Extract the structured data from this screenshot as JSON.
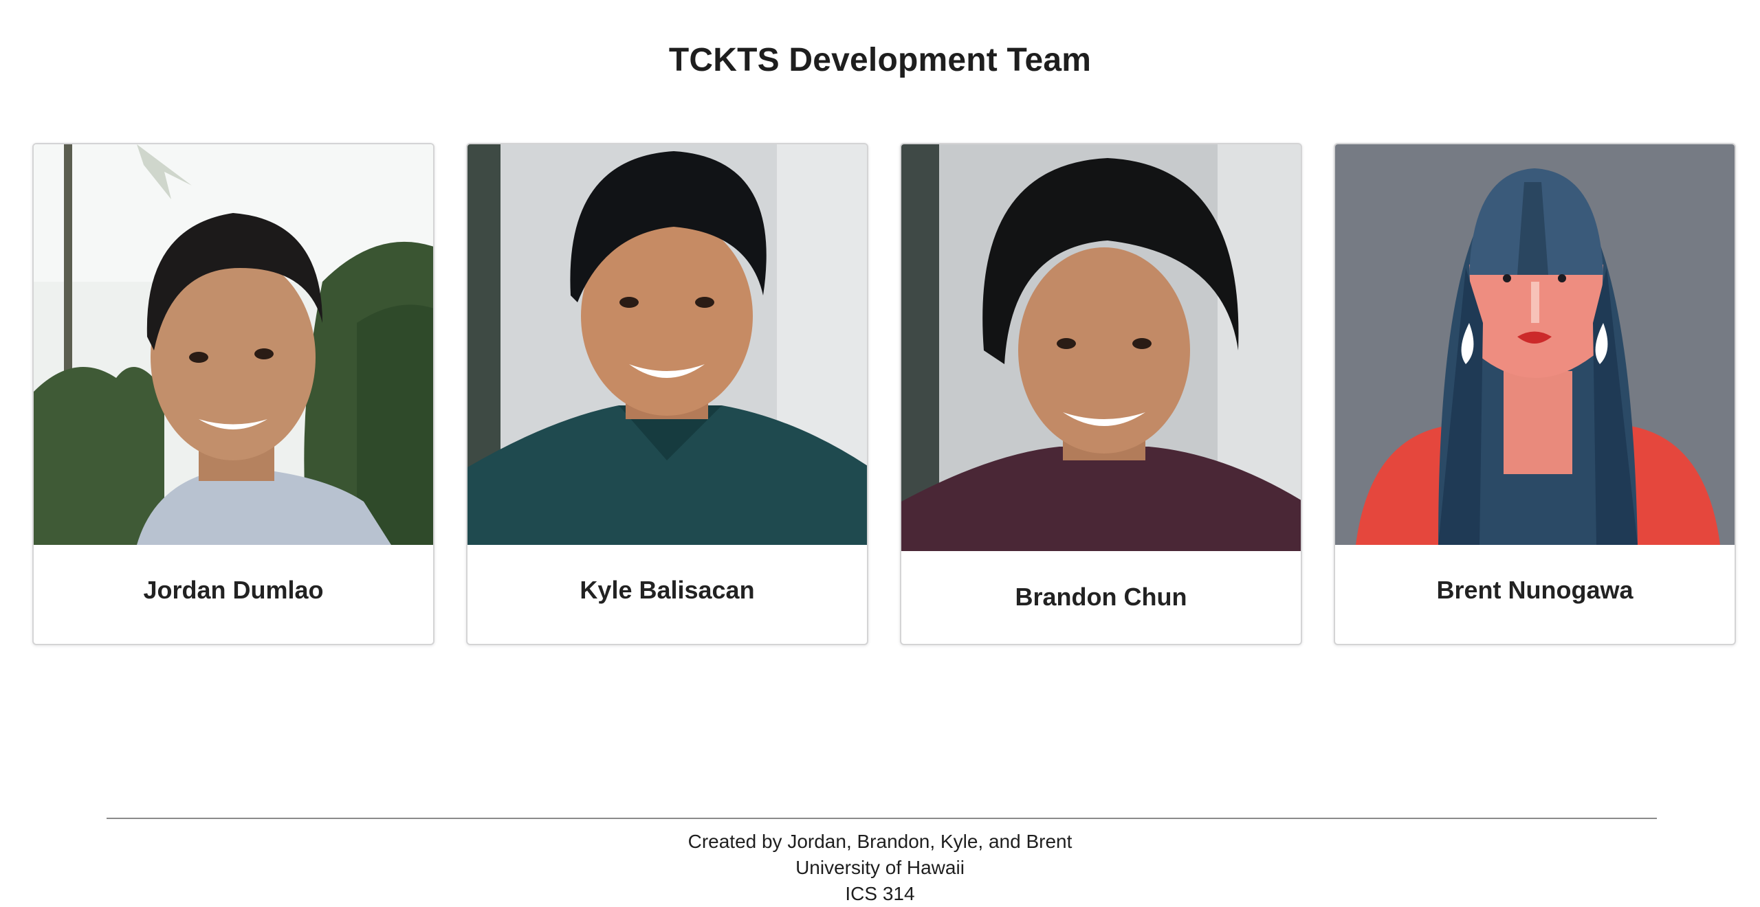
{
  "page": {
    "title": "TCKTS Development Team"
  },
  "team": [
    {
      "name": "Jordan Dumlao",
      "photo": "photo of Jordan Dumlao"
    },
    {
      "name": "Kyle Balisacan",
      "photo": "photo of Kyle Balisacan"
    },
    {
      "name": "Brandon Chun",
      "photo": "photo of Brandon Chun"
    },
    {
      "name": "Brent Nunogawa",
      "photo": "avatar of Brent Nunogawa"
    }
  ],
  "footer": {
    "line1": "Created by Jordan, Brandon, Kyle, and Brent",
    "line2": "University of Hawaii",
    "line3": "ICS 314"
  }
}
